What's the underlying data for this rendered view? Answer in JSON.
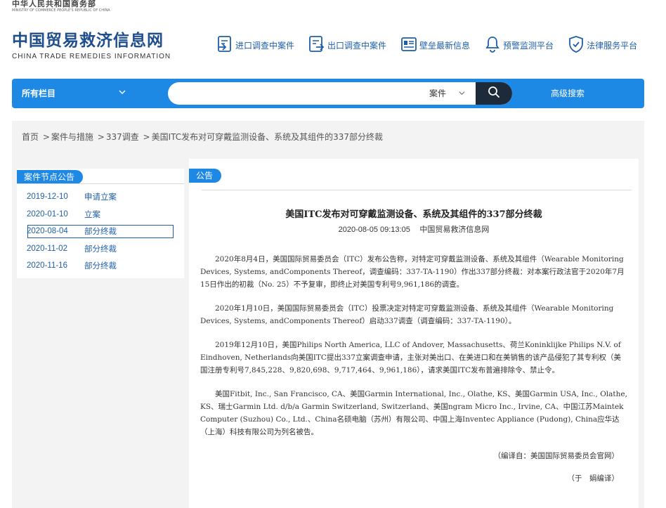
{
  "header": {
    "ministry_cn": "中华人民共和国商务部",
    "ministry_en": "MINISTRY OF COMMERCE PEOPLE'S REPUBLIC OF CHINA",
    "logo_cn": "中国贸易救济信息网",
    "logo_en": "CHINA TRADE REMEDIES INFORMATION",
    "nav": [
      {
        "label": "进口调查中案件",
        "icon": "import-case-icon"
      },
      {
        "label": "出口调查中案件",
        "icon": "export-case-icon"
      },
      {
        "label": "壁垒最新信息",
        "icon": "barrier-info-icon"
      },
      {
        "label": "预警监测平台",
        "icon": "bell-icon"
      },
      {
        "label": "法律服务平台",
        "icon": "shield-icon"
      }
    ]
  },
  "search": {
    "all_columns": "所有栏目",
    "value": "",
    "type_selected": "案件",
    "advanced": "高级搜索"
  },
  "breadcrumb": [
    "首页",
    "案件与措施",
    "337调查",
    "美国ITC发布对可穿戴监测设备、系统及其组件的337部分终裁"
  ],
  "sidebar": {
    "title": "案件节点公告",
    "items": [
      {
        "date": "2019-12-10",
        "label": "申请立案"
      },
      {
        "date": "2020-01-10",
        "label": "立案"
      },
      {
        "date": "2020-08-04",
        "label": "部分终裁"
      },
      {
        "date": "2020-11-02",
        "label": "部分终裁"
      },
      {
        "date": "2020-11-16",
        "label": "部分终裁"
      }
    ],
    "active_index": 2
  },
  "article": {
    "tab": "公告",
    "title": "美国ITC发布对可穿戴监测设备、系统及其组件的337部分终裁",
    "date": "2020-08-05 09:13:05",
    "source": "中国贸易救济信息网",
    "paragraphs": [
      "2020年8月4日，美国国际贸易委员会（ITC）发布公告称，对特定可穿戴监测设备、系统及其组件（Wearable Monitoring Devices, Systems, andComponents Thereof，调查编码：337-TA-1190）作出337部分终裁：对本案行政法官于2020年7月15日作出的初裁（No. 25）不予复审，即终止对美国专利号9,961,186的调查。",
      "2020年1月10日，美国国际贸易委员会（ITC）投票决定对特定可穿戴监测设备、系统及其组件（Wearable Monitoring Devices, Systems, andComponents Thereof）启动337调查（调查编码：337-TA-1190）。",
      "2019年12月10日，美国Philips North America, LLC of Andover, Massachusetts、荷兰Koninklijke Philips N.V. of Eindhoven, Netherlands向美国ITC提出337立案调查申请，主张对美出口、在美进口和在美销售的该产品侵犯了其专利权（美国注册专利号7,845,228、9,820,698、9,717,464、9,961,186），请求美国ITC发布普遍排除令、禁止令。",
      "美国Fitbit, Inc., San Francisco, CA、美国Garmin International, Inc., Olathe, KS、美国Garmin USA, Inc., Olathe, KS、瑞士Garmin Ltd. d/b/a Garmin Switzerland, Switzerland、美国ngram Micro Inc., Irvine, CA、中国江苏Maintek Computer (Suzhou) Co., Ltd.、China名硕电脑（苏州）有限公司、中国上海Inventec Appliance (Pudong), China应华达（上海）科技有限公司为列名被告。"
    ],
    "compiled_from": "（编译自：美国国际贸易委员会官网）",
    "editor": "（于　娟编译）"
  }
}
